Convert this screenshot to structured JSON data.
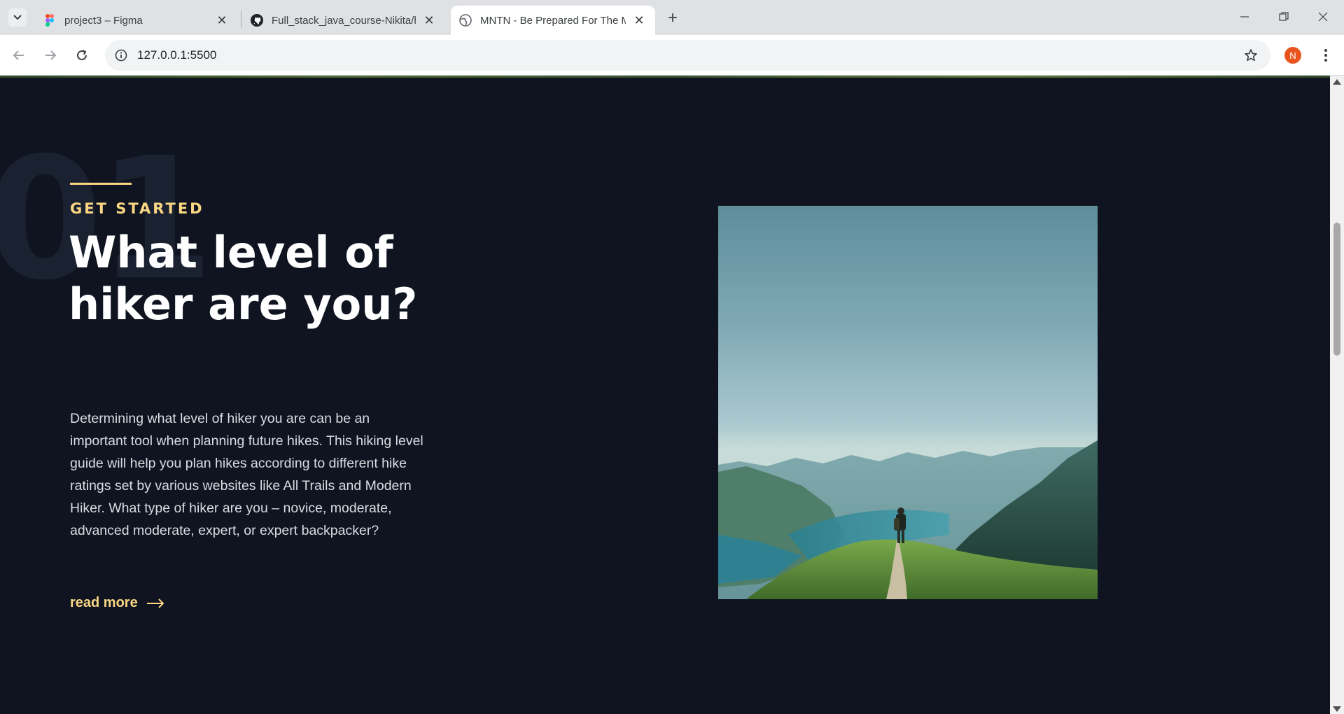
{
  "browser": {
    "tabs": [
      {
        "title": "project3 – Figma",
        "icon": "figma-icon",
        "active": false
      },
      {
        "title": "Full_stack_java_course-Nikita/ht",
        "icon": "github-icon",
        "active": false
      },
      {
        "title": "MNTN - Be Prepared For The M",
        "icon": "globe-icon",
        "active": true
      }
    ],
    "url": "127.0.0.1:5500",
    "profile_initial": "N",
    "profile_color": "#e8541e"
  },
  "page": {
    "number": "01",
    "eyebrow": "GET STARTED",
    "headline": "What level of hiker are you?",
    "body": "Determining what level of hiker you are can be an important tool when planning future hikes. This hiking level guide will help you plan hikes according to different hike ratings set by various websites like All Trails and Modern Hiker. What type of hiker are you – novice, moderate, advanced moderate, expert, or expert backpacker?",
    "read_more": "read more",
    "image_description_icon": "hiker-mountain-photo",
    "colors": {
      "background": "#0f1420",
      "accent": "#fbd784",
      "heading": "#ffffff"
    }
  }
}
